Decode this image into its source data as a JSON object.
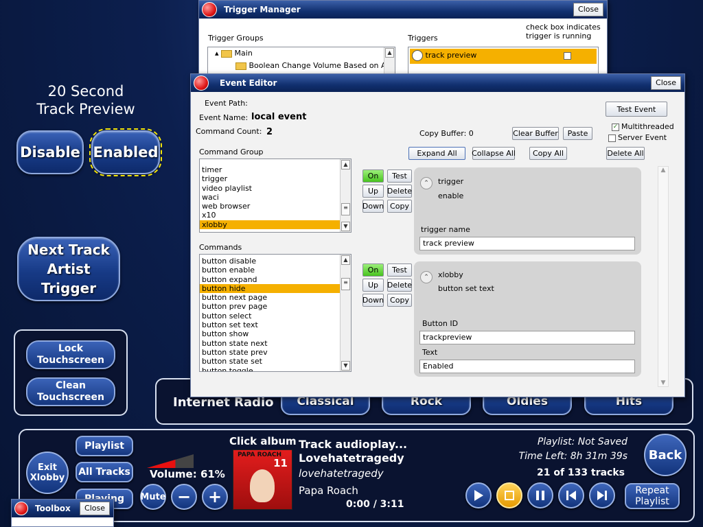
{
  "left": {
    "preview_title": "20 Second\nTrack Preview",
    "disable": "Disable",
    "enabled": "Enabled",
    "next_track": "Next Track\nArtist Trigger",
    "lock": "Lock\nTouchscreen",
    "clean": "Clean\nTouchscreen"
  },
  "genres": [
    "Internet Radio",
    "Classical",
    "Rock",
    "Oldies",
    "Hits"
  ],
  "player": {
    "exit": "Exit\nXlobby",
    "playlist": "Playlist",
    "all_tracks": "All Tracks",
    "playing": "Playing",
    "volume": "Volume: 61%",
    "volume_level": 0.61,
    "mute": "Mute",
    "click_album": "Click album",
    "track_title": "Track audioplay...",
    "song": "Lovehatetragedy",
    "album": "lovehatetragedy",
    "artist": "Papa Roach",
    "time": "0:00 / 3:11",
    "playlist_status": "Playlist: Not Saved",
    "time_left": "Time Left: 8h 31m 39s",
    "track_count": "21 of 133 tracks",
    "back": "Back",
    "repeat": "Repeat\nPlaylist",
    "album_art_text": "PAPA ROACH",
    "album_num": "11"
  },
  "toolbox": {
    "title": "Toolbox",
    "close": "Close"
  },
  "trigger_manager": {
    "title": "Trigger Manager",
    "close": "Close",
    "groups_label": "Trigger Groups",
    "triggers_label": "Triggers",
    "hint": "check box indicates\ntrigger is running",
    "tree_main": "Main",
    "tree_child": "Boolean  Change Volume Based on Artis",
    "trigger_item": "track preview"
  },
  "event_editor": {
    "title": "Event Editor",
    "close": "Close",
    "path_label": "Event Path:",
    "name_label": "Event Name:",
    "name_value": "local event",
    "count_label": "Command Count:",
    "count_value": "2",
    "copy_buffer": "Copy Buffer:   0",
    "clear_buffer": "Clear Buffer",
    "paste": "Paste",
    "test_event": "Test Event",
    "multithreaded": "Multithreaded",
    "server_event": "Server Event",
    "expand_all": "Expand All",
    "collapse_all": "Collapse All",
    "copy_all": "Copy All",
    "delete_all": "Delete All",
    "command_group_label": "Command Group",
    "command_groups": [
      "timer",
      "trigger",
      "video playlist",
      "waci",
      "web browser",
      "x10",
      "xlobby"
    ],
    "commands_label": "Commands",
    "commands": [
      "button disable",
      "button enable",
      "button expand",
      "button hide",
      "button next page",
      "button prev page",
      "button select",
      "button set text",
      "button show",
      "button state next",
      "button state prev",
      "button state set",
      "button toggle"
    ],
    "btn_on": "On",
    "btn_test": "Test",
    "btn_up": "Up",
    "btn_delete": "Delete",
    "btn_down": "Down",
    "btn_copy": "Copy",
    "cmd1": {
      "plugin": "trigger",
      "action": "enable",
      "field1_label": "trigger name",
      "field1_value": "track preview"
    },
    "cmd2": {
      "plugin": "xlobby",
      "action": "button set text",
      "field1_label": "Button ID",
      "field1_value": "trackpreview",
      "field2_label": "Text",
      "field2_value": "Enabled"
    }
  }
}
